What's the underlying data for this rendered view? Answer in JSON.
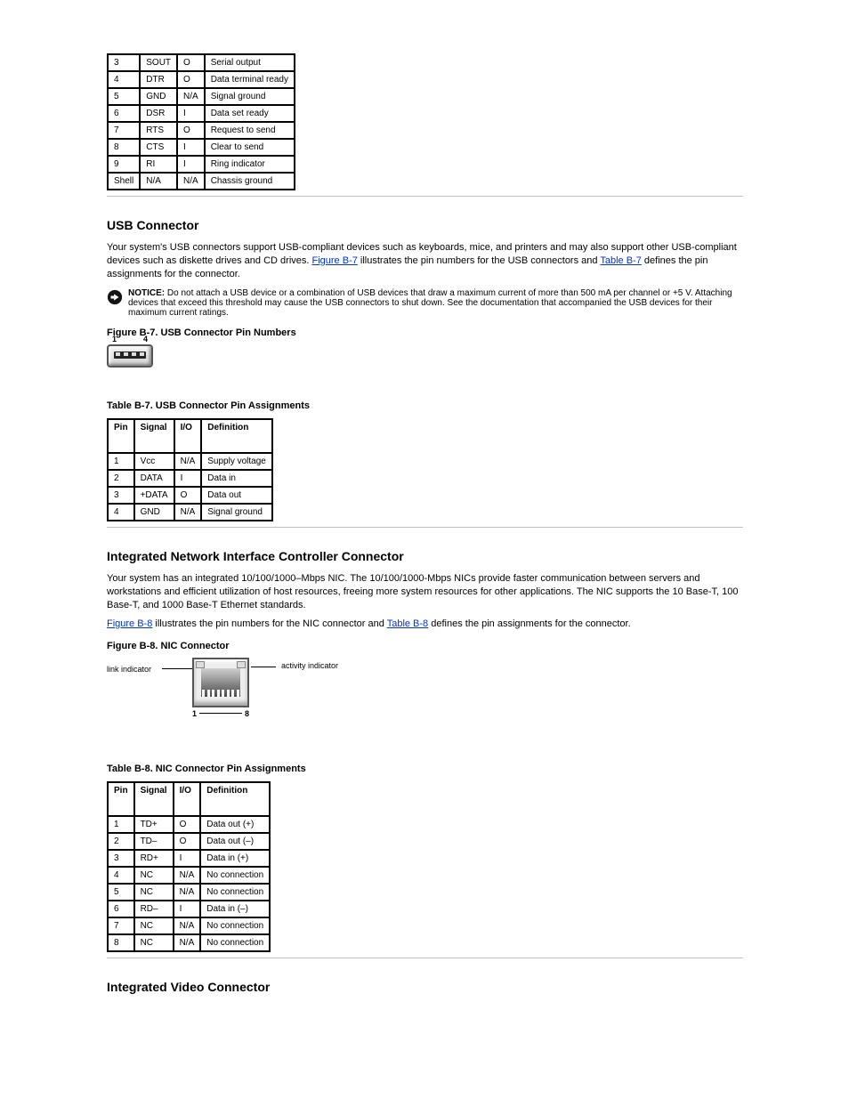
{
  "table_b6": {
    "rows": [
      [
        "3",
        "SOUT",
        "O",
        "Serial output"
      ],
      [
        "4",
        "DTR",
        "O",
        "Data terminal ready"
      ],
      [
        "5",
        "GND",
        "N/A",
        "Signal ground"
      ],
      [
        "6",
        "DSR",
        "I",
        "Data set ready"
      ],
      [
        "7",
        "RTS",
        "O",
        "Request to send"
      ],
      [
        "8",
        "CTS",
        "I",
        "Clear to send"
      ],
      [
        "9",
        "RI",
        "I",
        "Ring indicator"
      ],
      [
        "Shell",
        "N/A",
        "N/A",
        "Chassis ground"
      ]
    ]
  },
  "usb_section": {
    "heading": "USB Connector",
    "intro_a": "Your system's USB connectors support USB-compliant devices such as keyboards, mice, and printers and may also support other USB-compliant devices such as diskette drives and CD drives. ",
    "link_fig": "Figure B-7",
    "intro_b": " illustrates the pin numbers for the USB connectors and ",
    "link_tbl": "Table B-7",
    "intro_c": " defines the pin assignments for the connector.",
    "notice_bold": "NOTICE: ",
    "notice_text": "Do not attach a USB device or a combination of USB devices that draw a maximum current of more than 500 mA per channel or +5 V. Attaching devices that exceed this threshold may cause the USB connectors to shut down. See the documentation that accompanied the USB devices for their maximum current ratings.",
    "fig_caption": "Figure B-7. USB Connector Pin Numbers",
    "fig_pin_left": "1",
    "fig_pin_right": "4",
    "tbl_caption": "Table B-7. USB Connector Pin Assignments",
    "headers": [
      "Pin",
      "Signal",
      "I/O",
      "Definition"
    ],
    "rows": [
      [
        "1",
        "Vcc",
        "N/A",
        "Supply voltage"
      ],
      [
        "2",
        "DATA",
        "I",
        "Data in"
      ],
      [
        "3",
        "+DATA",
        "O",
        "Data out"
      ],
      [
        "4",
        "GND",
        "N/A",
        "Signal ground"
      ]
    ]
  },
  "nic_section": {
    "heading": "Integrated Network Interface Controller Connector",
    "intro_a": "Your system has an integrated 10/100/1000–Mbps NIC. The 10/100/1000-Mbps NICs provide faster communication between servers and workstations and efficient utilization of host resources, freeing more system resources for other applications. The NIC supports the 10 Base-T, 100 Base-T, and 1000 Base-T Ethernet standards.",
    "para2_a": "Figure B-8",
    "para2_b": " illustrates the pin numbers for the NIC connector and ",
    "para2_c": "Table B-8",
    "para2_d": " defines the pin assignments for the connector.",
    "fig_caption": "Figure B-8. NIC Connector",
    "label_left": "link indicator",
    "label_right": "activity indicator",
    "pin_left": "1",
    "pin_right": "8",
    "tbl_caption": "Table B-8. NIC Connector Pin Assignments",
    "headers": [
      "Pin",
      "Signal",
      "I/O",
      "Definition"
    ],
    "rows": [
      [
        "1",
        "TD+",
        "O",
        "Data out (+)"
      ],
      [
        "2",
        "TD–",
        "O",
        "Data out (–)"
      ],
      [
        "3",
        "RD+",
        "I",
        "Data in (+)"
      ],
      [
        "4",
        "NC",
        "N/A",
        "No connection"
      ],
      [
        "5",
        "NC",
        "N/A",
        "No connection"
      ],
      [
        "6",
        "RD–",
        "I",
        "Data in (–)"
      ],
      [
        "7",
        "NC",
        "N/A",
        "No connection"
      ],
      [
        "8",
        "NC",
        "N/A",
        "No connection"
      ]
    ]
  },
  "vga_heading": "Integrated Video Connector"
}
